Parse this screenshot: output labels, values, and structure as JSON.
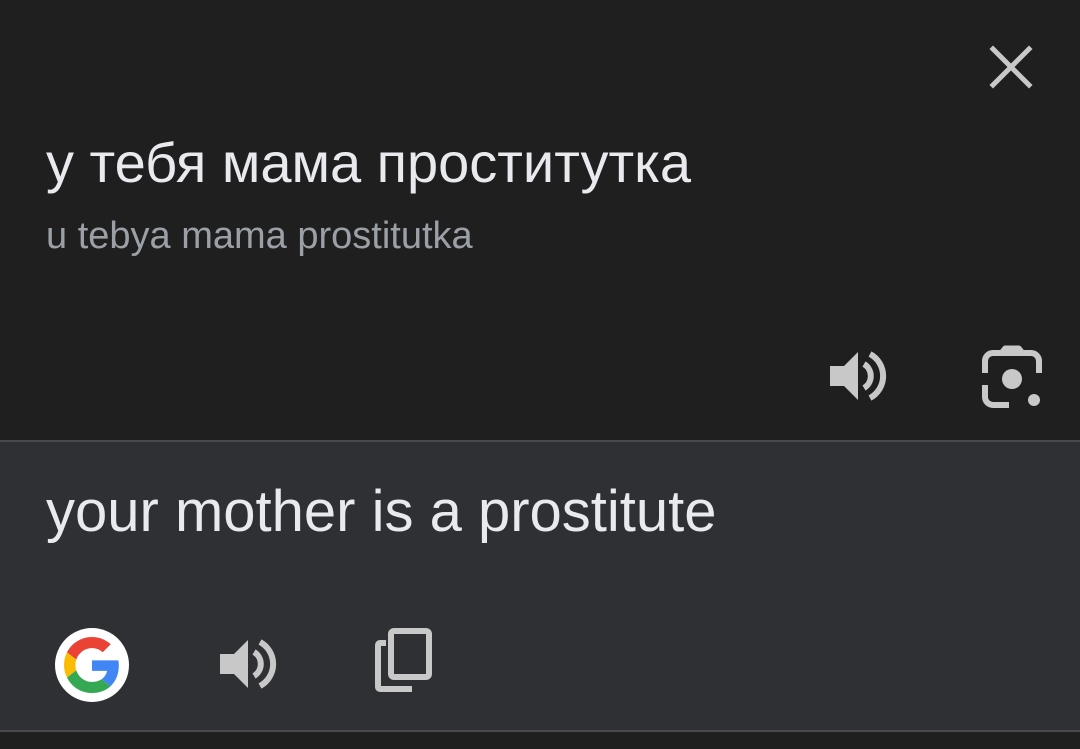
{
  "source": {
    "text": "у тебя мама проститутка",
    "transliteration": "u tebya mama prostitutka",
    "icons": [
      "close-icon",
      "speaker-icon",
      "camera-lens-icon"
    ]
  },
  "target": {
    "text": "your mother is a prostitute",
    "icons": [
      "google-g-icon",
      "speaker-icon",
      "copy-icon"
    ]
  },
  "colors": {
    "source_background": "#1f1f20",
    "target_background": "#2f3033",
    "primary_text": "#e8eaed",
    "secondary_text": "#9aa0a6",
    "icon": "#c8c8c8",
    "google_blue": "#4285F4",
    "google_red": "#EA4335",
    "google_yellow": "#FBBC05",
    "google_green": "#34A853"
  }
}
